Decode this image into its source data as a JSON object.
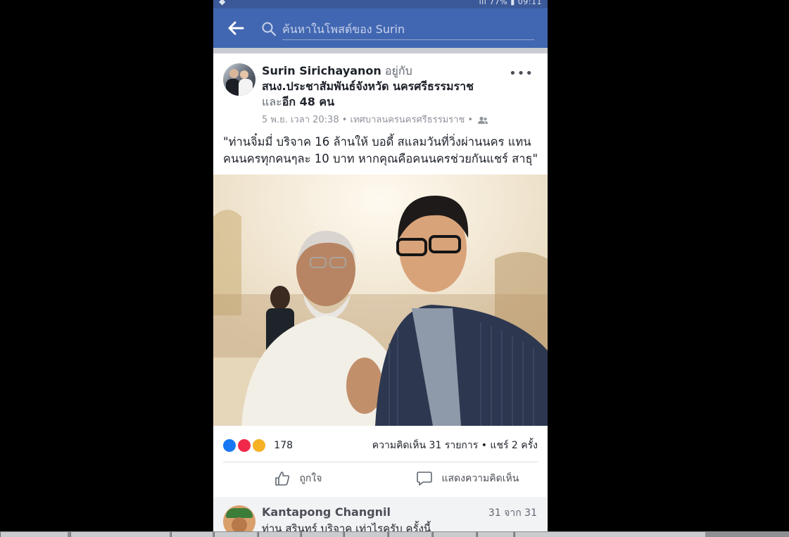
{
  "status_bar": {
    "battery": "77%",
    "time": "09:11"
  },
  "search": {
    "placeholder": "ค้นหาในโพสต์ของ Surin"
  },
  "post": {
    "author": "Surin Sirichayanon",
    "relation": "อยู่กับ",
    "place": "สนง.ประชาสัมพันธ์จังหวัด นครศรีธรรมราช",
    "and_word": "และ",
    "others": "อีก 48 คน",
    "date": "5 พ.ย. เวลา 20:38",
    "location": "เทศบาลนครนครศรีธรรมราช",
    "text": "\"ท่านจิ๋มมี่ บริจาค 16 ล้านให้ บอดี้ สแลมวันที่วิ่งผ่านนคร แทนคนนครทุกคนๆละ 10 บาท หากคุณคือคนนครช่วยกันแชร์ สาธุ\"",
    "reactions_count": "178",
    "engagement": "ความคิดเห็น 31 รายการ • แชร์ 2 ครั้ง"
  },
  "actions": {
    "like": "ถูกใจ",
    "comment": "แสดงความคิดเห็น"
  },
  "comment": {
    "name": "Kantapong Changnil",
    "position": "31 จาก 31",
    "text": "ท่าน สุรินทร์ บริจาค เท่าไรครับ ครั้งนี้"
  },
  "icons": [
    "back-arrow-icon",
    "search-icon",
    "more-icon",
    "friends-icon",
    "like-reaction-icon",
    "love-reaction-icon",
    "wow-reaction-icon",
    "thumbs-up-icon",
    "comment-icon"
  ],
  "colors": {
    "brand": "#4267b2",
    "background": "#e9ebee"
  }
}
